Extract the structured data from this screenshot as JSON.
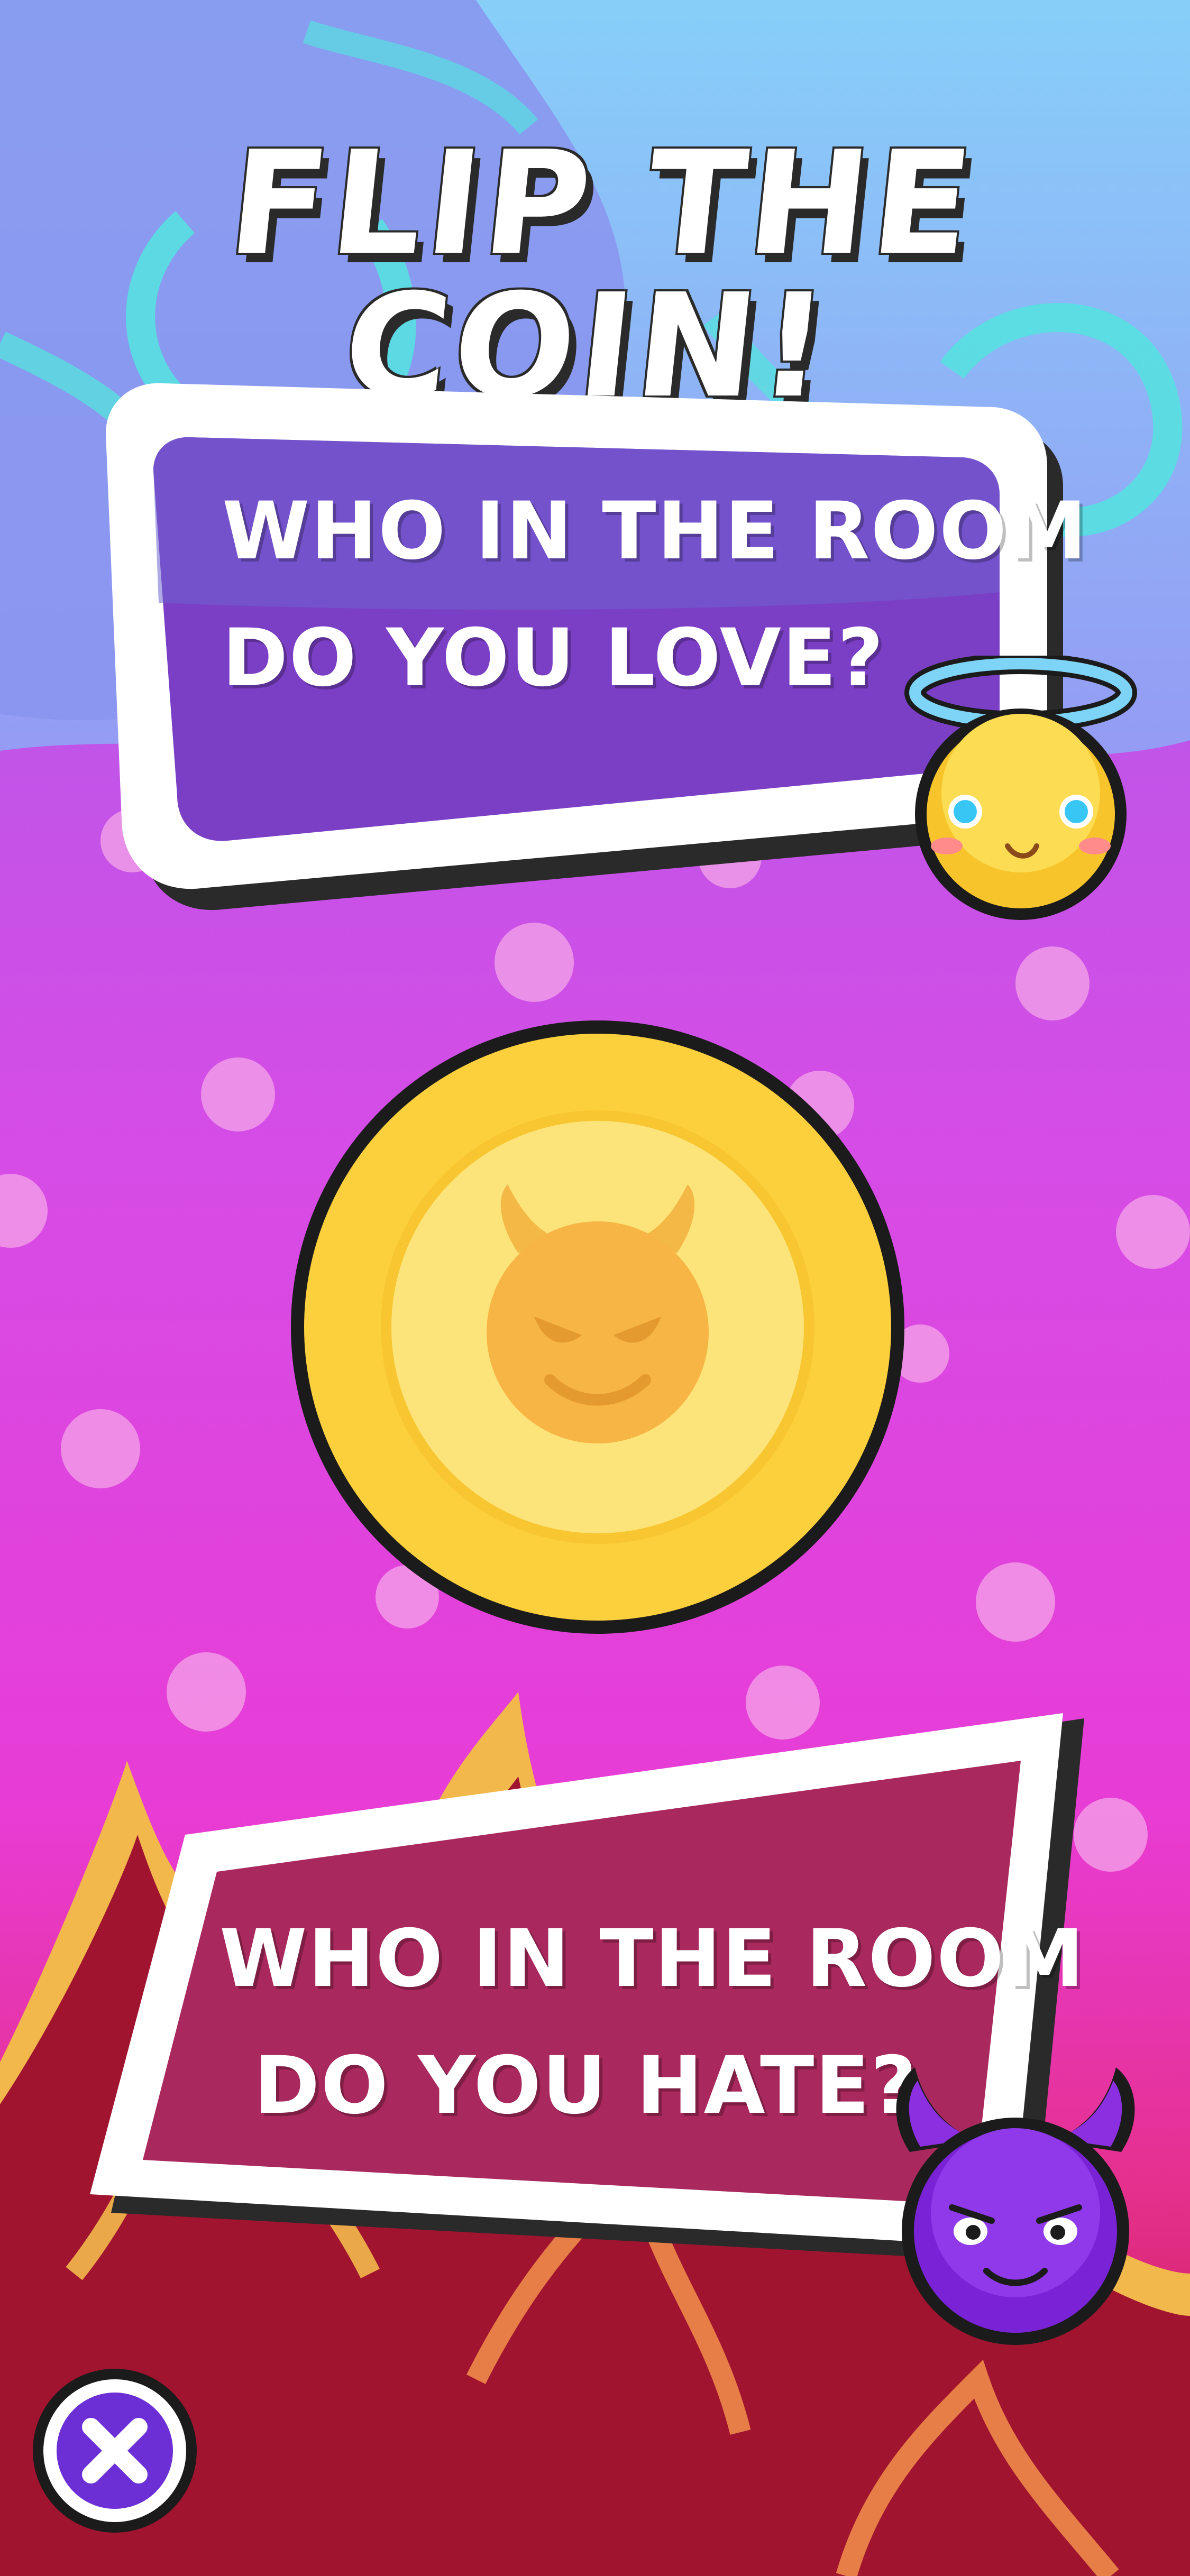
{
  "title": "FLIP THE COIN!",
  "love_card": {
    "line1": "WHO IN THE ROOM",
    "line2": "DO YOU LOVE?"
  },
  "hate_card": {
    "line1": "WHO IN THE ROOM",
    "line2": "DO YOU HATE?"
  },
  "coin": {
    "face_icon": "devil-face-icon",
    "color": "#fbd13b"
  },
  "icons": {
    "angel": "angel-emoji-icon",
    "devil": "devil-emoji-icon",
    "close": "close-icon"
  },
  "colors": {
    "love_card": "#7b3fc6",
    "hate_card": "#a2164f",
    "close_button": "#6c2fd6",
    "coin_gold": "#fbd13b",
    "coin_rim": "#1b1b1b"
  }
}
